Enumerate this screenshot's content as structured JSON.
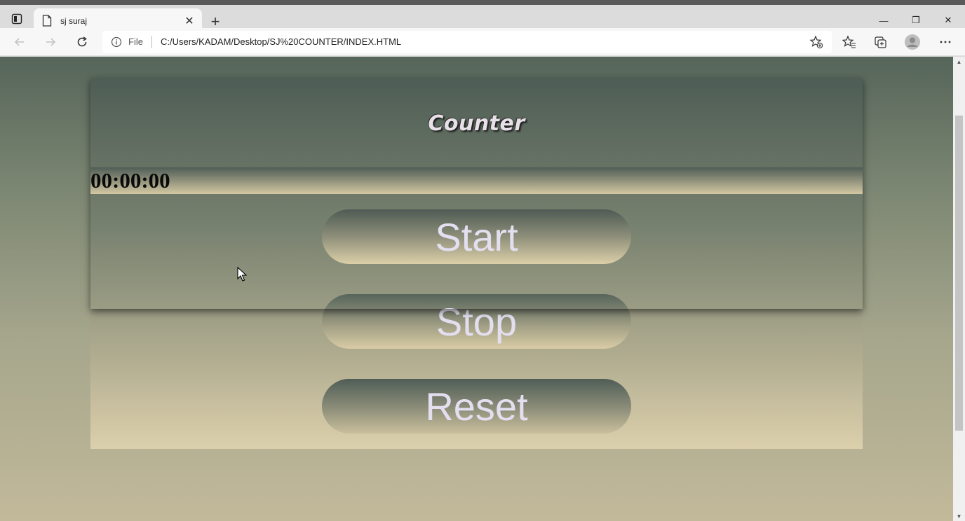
{
  "browser": {
    "tab_title": "sj suraj",
    "tab_close": "✕",
    "new_tab": "+",
    "address": {
      "protocol_label": "File",
      "url": "C:/Users/KADAM/Desktop/SJ%20COUNTER/INDEX.HTML"
    },
    "window_controls": {
      "minimize": "—",
      "restore": "❐",
      "close": "✕"
    },
    "icons": [
      "tab-actions-icon",
      "page-icon",
      "back-icon",
      "forward-icon",
      "reload-icon",
      "info-icon",
      "add-favorite-icon",
      "favorites-icon",
      "collections-icon",
      "profile-icon",
      "more-icon"
    ]
  },
  "page": {
    "title": "Counter",
    "timer": "00:00:00",
    "buttons": {
      "start": "Start",
      "stop": "Stop",
      "reset": "Reset"
    }
  },
  "colors": {
    "button_text": "#e3dff0",
    "title_text": "#e8e0e8",
    "timer_text": "#0a0a0a",
    "background_top": "#56655a",
    "background_bottom": "#c2b99a"
  }
}
